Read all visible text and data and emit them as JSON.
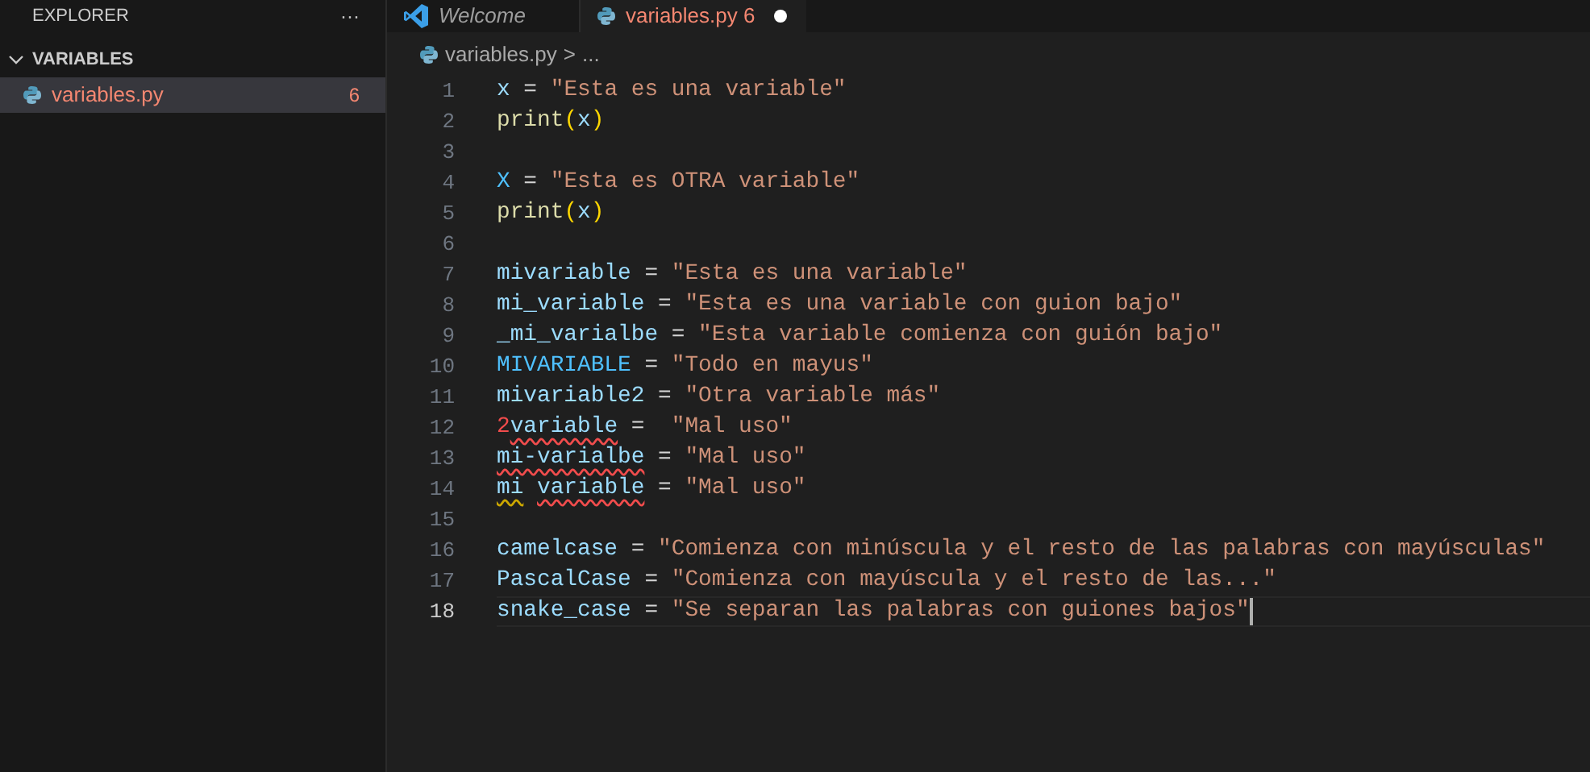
{
  "sidebar": {
    "title": "EXPLORER",
    "more": "···",
    "folder": {
      "label": "VARIABLES",
      "expanded": true,
      "files": [
        {
          "name": "variables.py",
          "badge": "6",
          "selected": true
        }
      ]
    }
  },
  "tabs": [
    {
      "label": "Welcome",
      "kind": "welcome",
      "selected": false,
      "modified": false
    },
    {
      "label": "variables.py",
      "badge": "6",
      "kind": "python",
      "selected": true,
      "modified": true
    }
  ],
  "breadcrumb": {
    "file": "variables.py",
    "separator": ">",
    "rest": "..."
  },
  "editor": {
    "lines": [
      {
        "number": "1",
        "active": false,
        "tokens": [
          {
            "kind": "var",
            "text": "x"
          },
          {
            "kind": "op",
            "text": " = "
          },
          {
            "kind": "str",
            "text": "\"Esta es una variable\""
          }
        ]
      },
      {
        "number": "2",
        "active": false,
        "tokens": [
          {
            "kind": "func",
            "text": "print"
          },
          {
            "kind": "paren",
            "text": "("
          },
          {
            "kind": "var",
            "text": "x"
          },
          {
            "kind": "paren",
            "text": ")"
          }
        ]
      },
      {
        "number": "3",
        "active": false
      },
      {
        "number": "4",
        "active": false,
        "tokens": [
          {
            "kind": "const",
            "text": "X"
          },
          {
            "kind": "op",
            "text": " = "
          },
          {
            "kind": "str",
            "text": "\"Esta es OTRA variable\""
          }
        ]
      },
      {
        "number": "5",
        "active": false,
        "tokens": [
          {
            "kind": "func",
            "text": "print"
          },
          {
            "kind": "paren",
            "text": "("
          },
          {
            "kind": "var",
            "text": "x"
          },
          {
            "kind": "paren",
            "text": ")"
          }
        ]
      },
      {
        "number": "6",
        "active": false
      },
      {
        "number": "7",
        "active": false,
        "tokens": [
          {
            "kind": "var",
            "text": "mivariable"
          },
          {
            "kind": "op",
            "text": " = "
          },
          {
            "kind": "str",
            "text": "\"Esta es una variable\""
          }
        ]
      },
      {
        "number": "8",
        "active": false,
        "tokens": [
          {
            "kind": "var",
            "text": "mi_variable"
          },
          {
            "kind": "op",
            "text": " = "
          },
          {
            "kind": "str",
            "text": "\"Esta es una variable con guion bajo\""
          }
        ]
      },
      {
        "number": "9",
        "active": false,
        "tokens": [
          {
            "kind": "var",
            "text": "_mi_varialbe"
          },
          {
            "kind": "op",
            "text": " = "
          },
          {
            "kind": "str",
            "text": "\"Esta variable comienza con guión bajo\""
          }
        ]
      },
      {
        "number": "10",
        "active": false,
        "tokens": [
          {
            "kind": "const",
            "text": "MIVARIABLE"
          },
          {
            "kind": "op",
            "text": " = "
          },
          {
            "kind": "str",
            "text": "\"Todo en mayus\""
          }
        ]
      },
      {
        "number": "11",
        "active": false,
        "tokens": [
          {
            "kind": "var",
            "text": "mivariable2"
          },
          {
            "kind": "op",
            "text": " = "
          },
          {
            "kind": "str",
            "text": "\"Otra variable más\""
          }
        ]
      },
      {
        "number": "12",
        "active": false,
        "tokens": [
          {
            "kind": "num",
            "text": "2"
          },
          {
            "kind": "error",
            "text": "variable"
          },
          {
            "kind": "op",
            "text": " =  "
          },
          {
            "kind": "str",
            "text": "\"Mal uso\""
          }
        ]
      },
      {
        "number": "13",
        "active": false,
        "tokens": [
          {
            "kind": "error",
            "text": "mi-varialbe"
          },
          {
            "kind": "op",
            "text": " = "
          },
          {
            "kind": "str",
            "text": "\"Mal uso\""
          }
        ]
      },
      {
        "number": "14",
        "active": false,
        "tokens": [
          {
            "kind": "warning",
            "text": "mi"
          },
          {
            "kind": "error",
            "text": " variable"
          },
          {
            "kind": "op",
            "text": " = "
          },
          {
            "kind": "str",
            "text": "\"Mal uso\""
          }
        ]
      },
      {
        "number": "15",
        "active": false
      },
      {
        "number": "16",
        "active": false,
        "tokens": [
          {
            "kind": "var",
            "text": "camelcase"
          },
          {
            "kind": "op",
            "text": " = "
          },
          {
            "kind": "str",
            "text": "\"Comienza con minúscula y el resto de las palabras con mayúsculas\""
          }
        ]
      },
      {
        "number": "17",
        "active": false,
        "tokens": [
          {
            "kind": "var",
            "text": "PascalCase"
          },
          {
            "kind": "op",
            "text": " = "
          },
          {
            "kind": "str",
            "text": "\"Comienza con mayúscula y el resto de las...\""
          }
        ]
      },
      {
        "number": "18",
        "active": true,
        "tokens": [
          {
            "kind": "var",
            "text": "snake_case"
          },
          {
            "kind": "op",
            "text": " = "
          },
          {
            "kind": "str",
            "text": "\"Se separan las palabras con guiones bajos\""
          }
        ]
      }
    ]
  }
}
